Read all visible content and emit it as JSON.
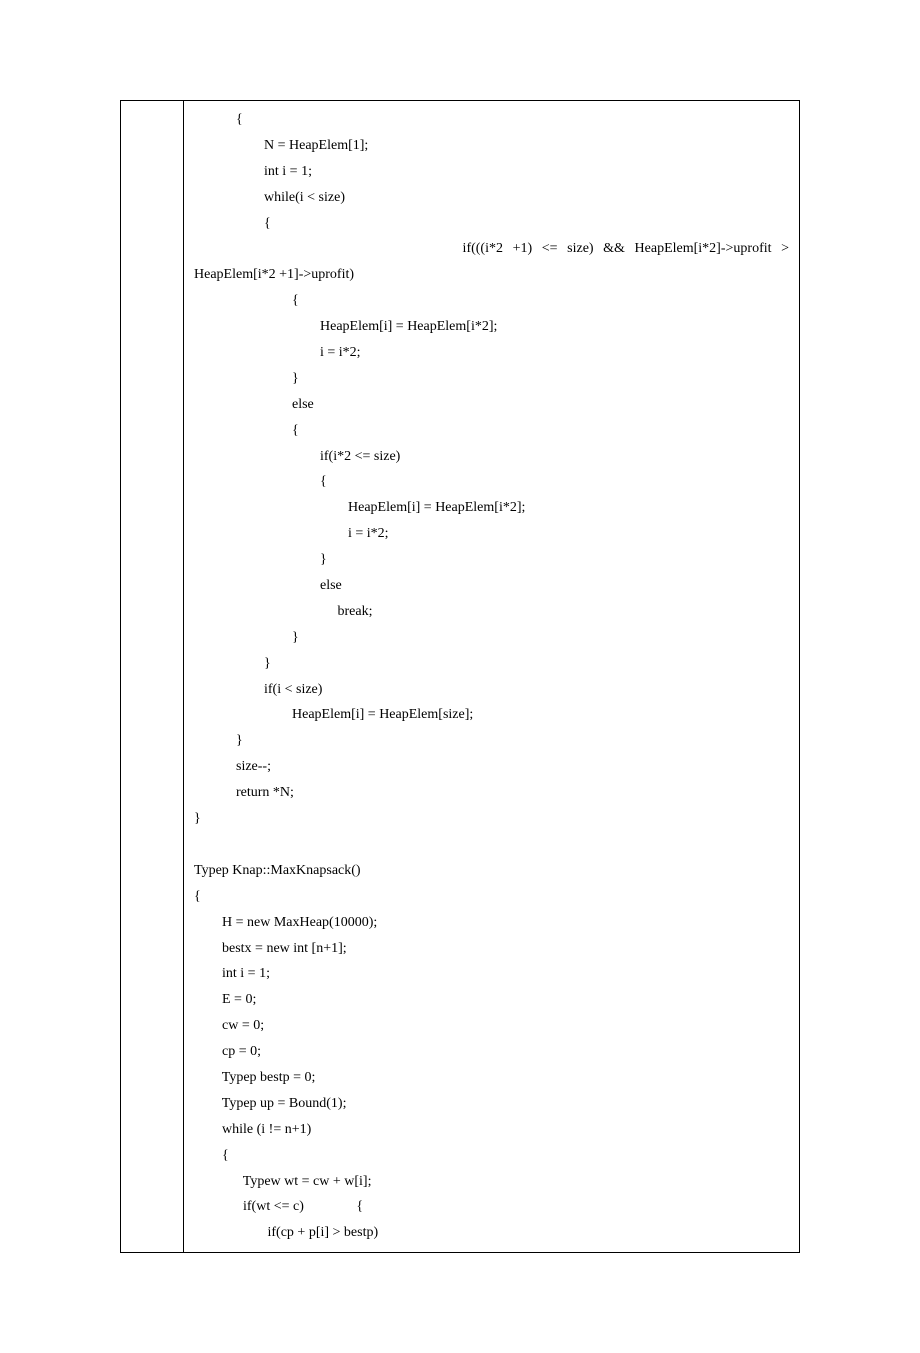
{
  "code": {
    "l01": "            {",
    "l02": "                    N = HeapElem[1];",
    "l03": "                    int i = 1;",
    "l04": "                    while(i < size)",
    "l05": "                    {",
    "l06a": "                            if(((i*2",
    "l06b": "+1)",
    "l06c": "<=",
    "l06d": "size)",
    "l06e": "&&",
    "l06f": "HeapElem[i*2]->uprofit",
    "l06g": ">",
    "l07": "HeapElem[i*2 +1]->uprofit)",
    "l08": "                            {",
    "l09": "                                    HeapElem[i] = HeapElem[i*2];",
    "l10": "                                    i = i*2;",
    "l11": "                            }",
    "l12": "                            else",
    "l13": "                            {",
    "l14": "                                    if(i*2 <= size)",
    "l15": "                                    {",
    "l16": "                                            HeapElem[i] = HeapElem[i*2];",
    "l17": "                                            i = i*2;",
    "l18": "                                    }",
    "l19": "                                    else",
    "l20": "                                         break;",
    "l21": "                            }",
    "l22": "                    }",
    "l23": "                    if(i < size)",
    "l24": "                            HeapElem[i] = HeapElem[size];",
    "l25": "            }",
    "l26": "            size--;",
    "l27": "            return *N;",
    "l28": "}",
    "l30": "Typep Knap::MaxKnapsack()",
    "l31": "{",
    "l32": "        H = new MaxHeap(10000);",
    "l33": "        bestx = new int [n+1];",
    "l34": "        int i = 1;",
    "l35": "        E = 0;",
    "l36": "        cw = 0;",
    "l37": "        cp = 0;",
    "l38": "        Typep bestp = 0;",
    "l39": "        Typep up = Bound(1);",
    "l40": "        while (i != n+1)",
    "l41": "        {",
    "l42": "              Typew wt = cw + w[i];",
    "l43": "              if(wt <= c)               {",
    "l44": "                     if(cp + p[i] > bestp)"
  }
}
